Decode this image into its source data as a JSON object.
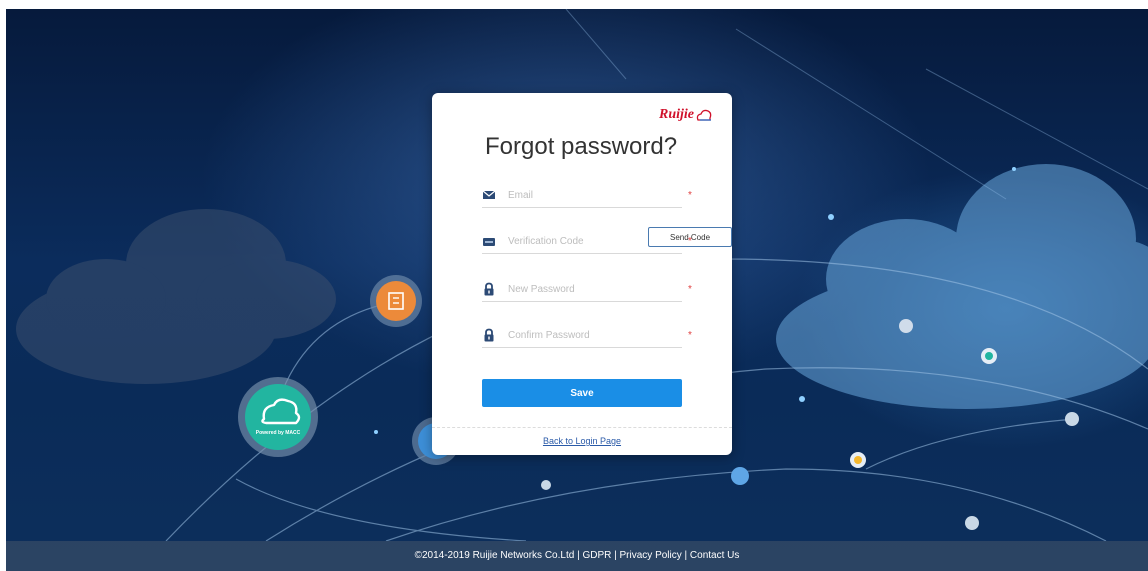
{
  "logo": {
    "brand": "Ruijie"
  },
  "form": {
    "title": "Forgot password?",
    "email_placeholder": "Email",
    "code_placeholder": "Verification Code",
    "send_code_label": "Send Code",
    "new_password_placeholder": "New Password",
    "confirm_password_placeholder": "Confirm Password",
    "required_mark": "*",
    "save_label": "Save",
    "back_label": "Back to Login Page"
  },
  "background": {
    "badge_text": "Powered by MACC"
  },
  "footer": {
    "copyright": "©2014-2019 Ruijie Networks Co.Ltd",
    "sep": " | ",
    "gdpr": "GDPR",
    "privacy": "Privacy Policy",
    "contact": "Contact Us"
  },
  "colors": {
    "primary": "#1a8ee6",
    "brand_red": "#d0112b",
    "link": "#2a5aa8",
    "required": "#e04040"
  },
  "icons": [
    "envelope-icon",
    "verification-card-icon",
    "lock-icon",
    "building-icon",
    "cloud-icon",
    "card-icon"
  ]
}
